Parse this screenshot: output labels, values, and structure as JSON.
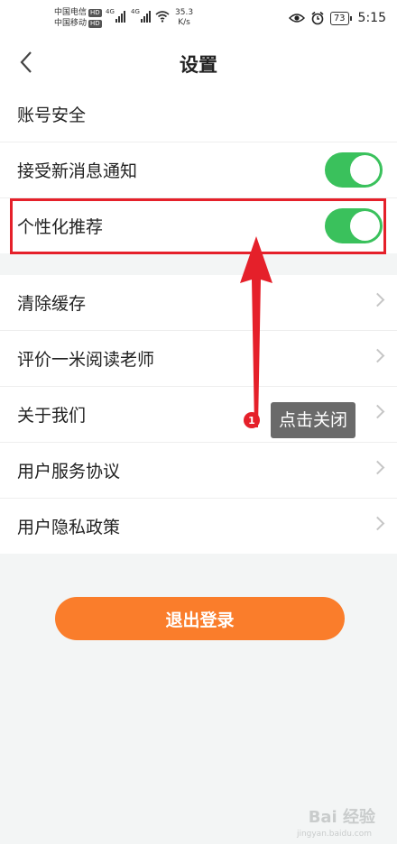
{
  "status_bar": {
    "carrier_1": "中国电信",
    "carrier_2": "中国移动",
    "hd_label": "HD",
    "net_type": "4G",
    "net_speed_value": "35.3",
    "net_speed_unit": "K/s",
    "battery": "73",
    "time": "5:15",
    "icons": [
      "eye-icon",
      "alarm-icon",
      "wifi-icon",
      "signal-icon"
    ]
  },
  "nav": {
    "title": "设置",
    "back_icon": "chevron-left-icon"
  },
  "settings": {
    "group1": [
      {
        "label": "账号安全",
        "control": "none"
      },
      {
        "label": "接受新消息通知",
        "control": "toggle",
        "on": true
      },
      {
        "label": "个性化推荐",
        "control": "toggle",
        "on": true
      }
    ],
    "group2": [
      {
        "label": "清除缓存",
        "control": "chevron"
      },
      {
        "label": "评价一米阅读老师",
        "control": "chevron"
      },
      {
        "label": "关于我们",
        "control": "chevron"
      },
      {
        "label": "用户服务协议",
        "control": "chevron"
      },
      {
        "label": "用户隐私政策",
        "control": "chevron"
      }
    ]
  },
  "annotation": {
    "step_number": "1",
    "tip_text": "点击关闭",
    "color": "#e5202a"
  },
  "logout_label": "退出登录",
  "watermark": {
    "text": "Bai 经验",
    "sub": "jingyan.baidu.com"
  },
  "colors": {
    "toggle_on": "#3ac15c",
    "logout": "#fa7d2b",
    "background": "#f3f5f5"
  }
}
